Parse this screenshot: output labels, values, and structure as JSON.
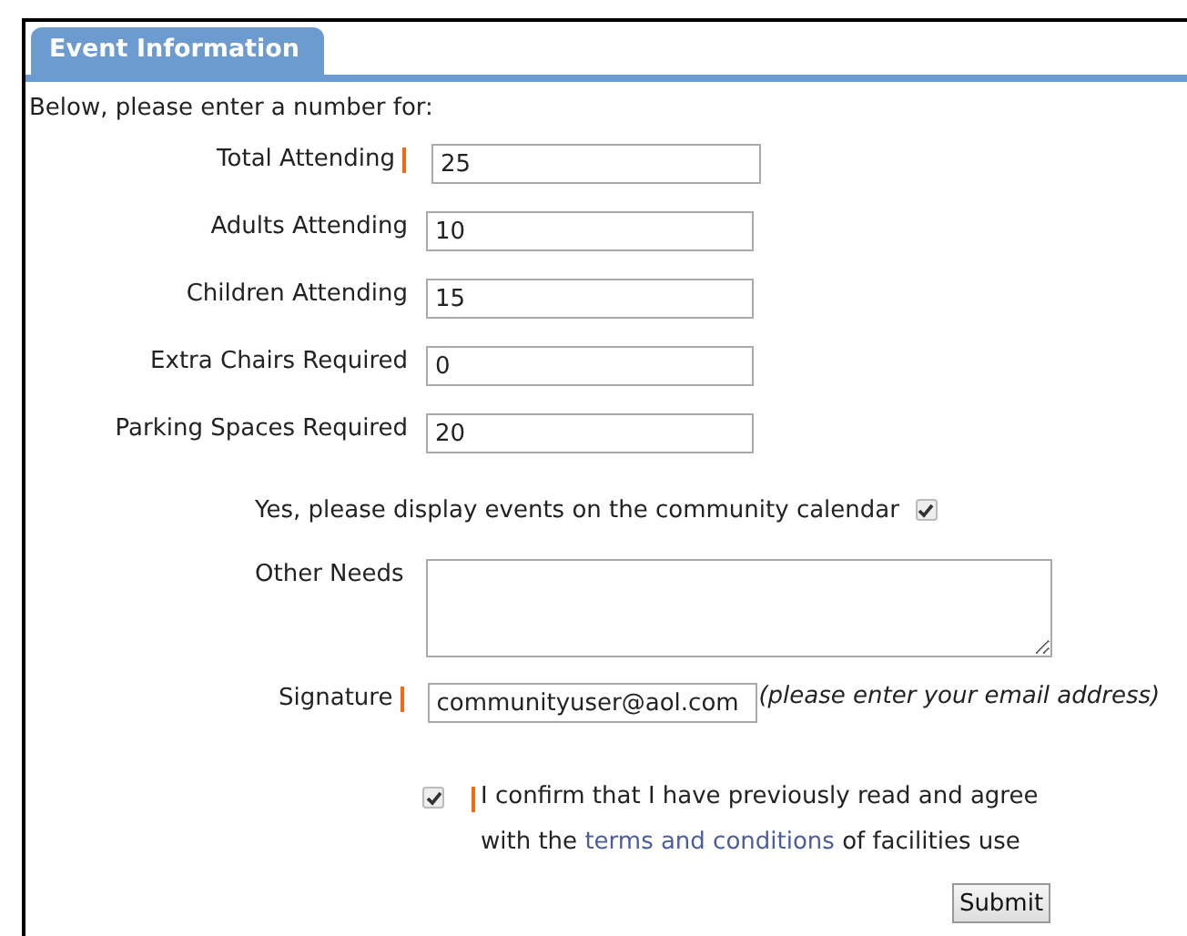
{
  "tab": {
    "label": "Event Information",
    "selected": true
  },
  "intro": "Below, please enter a number for:",
  "fields": [
    {
      "label": "Total Attending",
      "required": true,
      "value": "25"
    },
    {
      "label": "Adults Attending",
      "required": false,
      "value": "10"
    },
    {
      "label": "Children Attending",
      "required": false,
      "value": "15"
    },
    {
      "label": "Extra Chairs Required",
      "required": false,
      "value": "0"
    },
    {
      "label": "Parking Spaces Required",
      "required": false,
      "value": "20"
    }
  ],
  "calendar": {
    "label": "Yes, please display events on the community calendar",
    "checked": true
  },
  "other_needs": {
    "label": "Other Needs"
  },
  "signature": {
    "label": "Signature",
    "required": true,
    "value": "communityuser@aol.com",
    "hint": "(please enter your email address)"
  },
  "agreement": {
    "checked": true,
    "required": true,
    "text": "I confirm that I have previously read and agree with the",
    "link": "terms and conditions",
    "text_after": "of facilities use"
  },
  "submit": "Submit"
}
